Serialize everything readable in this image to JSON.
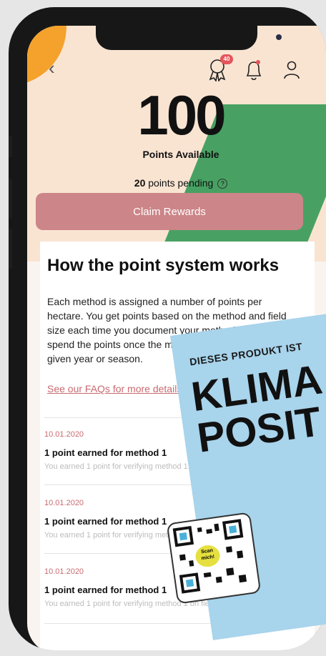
{
  "header": {
    "badge_count": "40",
    "icons": [
      "back-chevron-icon",
      "award-badge-icon",
      "bell-icon",
      "user-icon"
    ]
  },
  "points": {
    "value": "100",
    "label": "Points Available",
    "pending_value": "20",
    "pending_text": " points pending",
    "help_glyph": "?"
  },
  "claim_button": "Claim Rewards",
  "info": {
    "title": "How the point system works",
    "description": "Each method is assigned a number of points per hectare. You get points based on the method and field size each time you document your method, and you can spend the points once the method is completed for a given year or season.",
    "faq_link": "See our FAQs for more details"
  },
  "entries": [
    {
      "date": "10.01.2020",
      "title": "1 point earned for method 1",
      "subtitle": "You earned 1 point for verifying method 1 on field 1."
    },
    {
      "date": "10.01.2020",
      "title": "1 point earned for method 1",
      "subtitle": "You earned 1 point for verifying method 1 on field 1."
    },
    {
      "date": "10.01.2020",
      "title": "1 point earned for method 1",
      "subtitle": "You earned 1 point for verifying method 1 on field 1."
    }
  ],
  "sticker": {
    "top_text": "DIESES PRODUKT IST",
    "line1": "KLIMA",
    "line2": "POSIT",
    "qr_text": "Scan mich!"
  },
  "colors": {
    "accent": "#cc8588",
    "hero_bg": "#f9e4d2",
    "green": "#48a163",
    "orange": "#f4a22b",
    "sticker_blue": "#a8d4ec"
  }
}
